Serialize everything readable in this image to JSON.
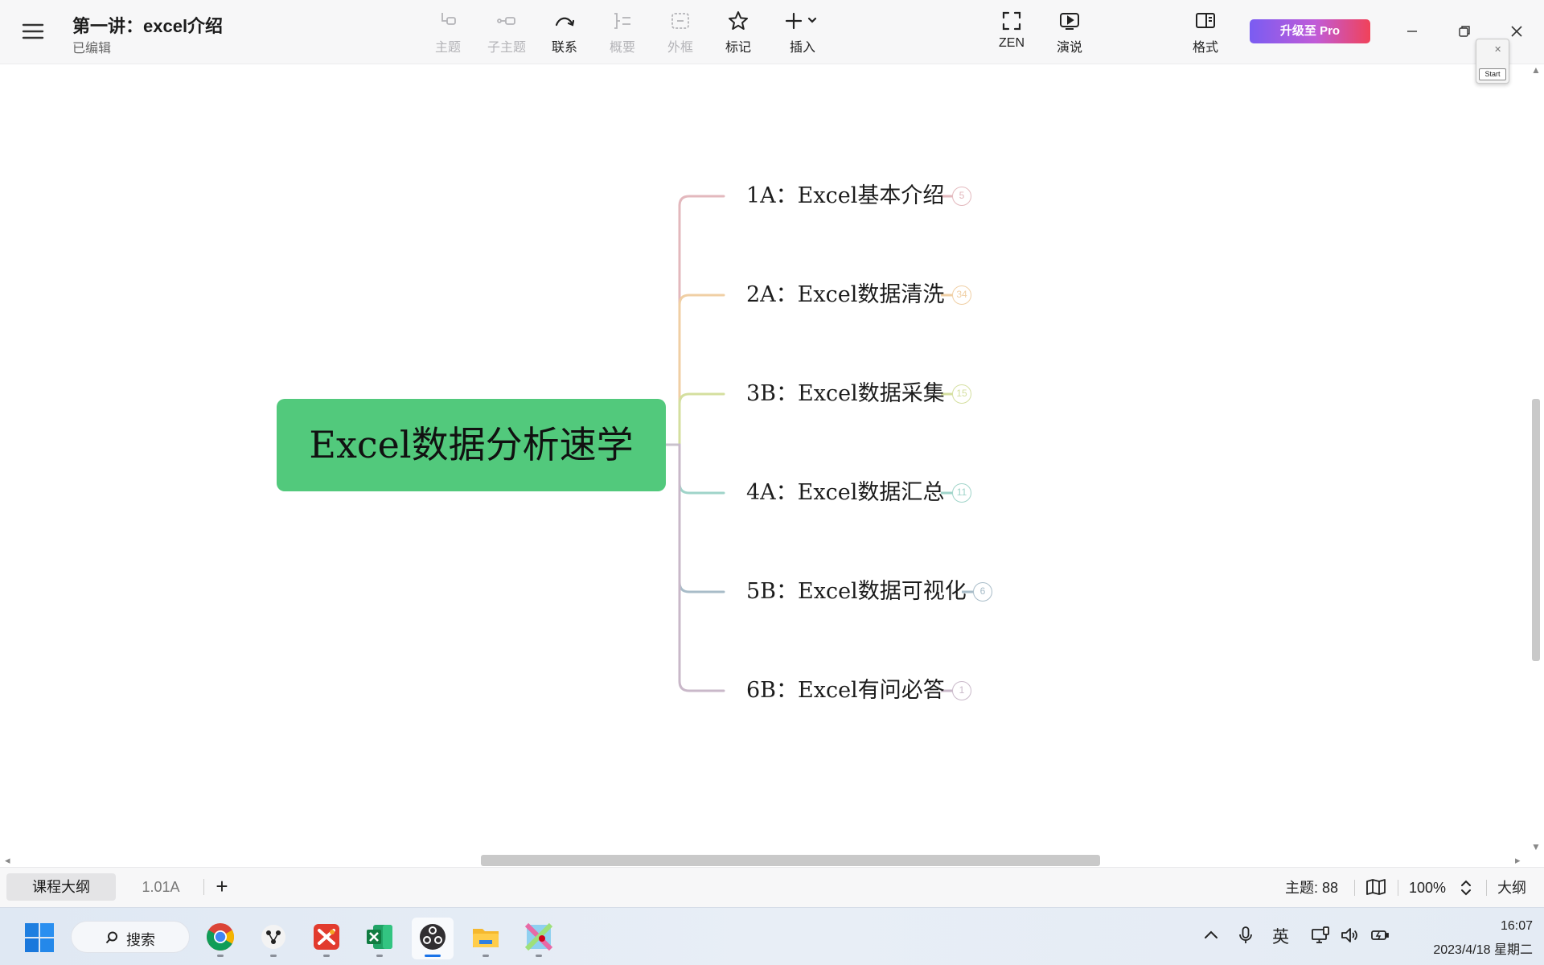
{
  "app": {
    "doc_title": "第一讲：excel介绍",
    "doc_status": "已编辑"
  },
  "toolbar": {
    "items": [
      {
        "label": "主题",
        "icon": "topic-icon",
        "enabled": false
      },
      {
        "label": "子主题",
        "icon": "subtopic-icon",
        "enabled": false
      },
      {
        "label": "联系",
        "icon": "relationship-icon",
        "enabled": true
      },
      {
        "label": "概要",
        "icon": "summary-icon",
        "enabled": false
      },
      {
        "label": "外框",
        "icon": "boundary-icon",
        "enabled": false
      },
      {
        "label": "标记",
        "icon": "star-icon",
        "enabled": true
      },
      {
        "label": "插入",
        "icon": "plus-icon",
        "enabled": true
      }
    ],
    "zen_label": "ZEN",
    "present_label": "演说",
    "format_label": "格式",
    "upgrade_label": "升级至 Pro"
  },
  "floating_window": {
    "start_label": "Start"
  },
  "mindmap": {
    "central_topic": "Excel数据分析速学",
    "central_color": "#52c97c",
    "branches": [
      {
        "label": "1A：Excel基本介绍",
        "count": "5",
        "color": "#e3b8bd"
      },
      {
        "label": "2A：Excel数据清洗",
        "count": "34",
        "color": "#f0cfa4"
      },
      {
        "label": "3B：Excel数据采集",
        "count": "15",
        "color": "#d4df9f"
      },
      {
        "label": "4A：Excel数据汇总",
        "count": "11",
        "color": "#9fd4c9"
      },
      {
        "label": "5B：Excel数据可视化",
        "count": "6",
        "color": "#a8bcc8"
      },
      {
        "label": "6B：Excel有问必答",
        "count": "1",
        "color": "#c9b8c9"
      }
    ]
  },
  "statusbar": {
    "sheets": [
      "课程大纲",
      "1.01A"
    ],
    "topic_count": "主题: 88",
    "zoom": "100%",
    "outline_label": "大纲"
  },
  "taskbar": {
    "search_label": "搜索",
    "apps": [
      {
        "name": "chrome-app",
        "active": false
      },
      {
        "name": "team-app",
        "active": false
      },
      {
        "name": "xmind-app",
        "active": false
      },
      {
        "name": "excel-app",
        "active": false
      },
      {
        "name": "obs-app",
        "active": true
      },
      {
        "name": "file-explorer-app",
        "active": false
      },
      {
        "name": "paint-app",
        "active": false
      }
    ],
    "ime_label": "英",
    "time": "16:07",
    "date": "2023/4/18 星期二"
  }
}
